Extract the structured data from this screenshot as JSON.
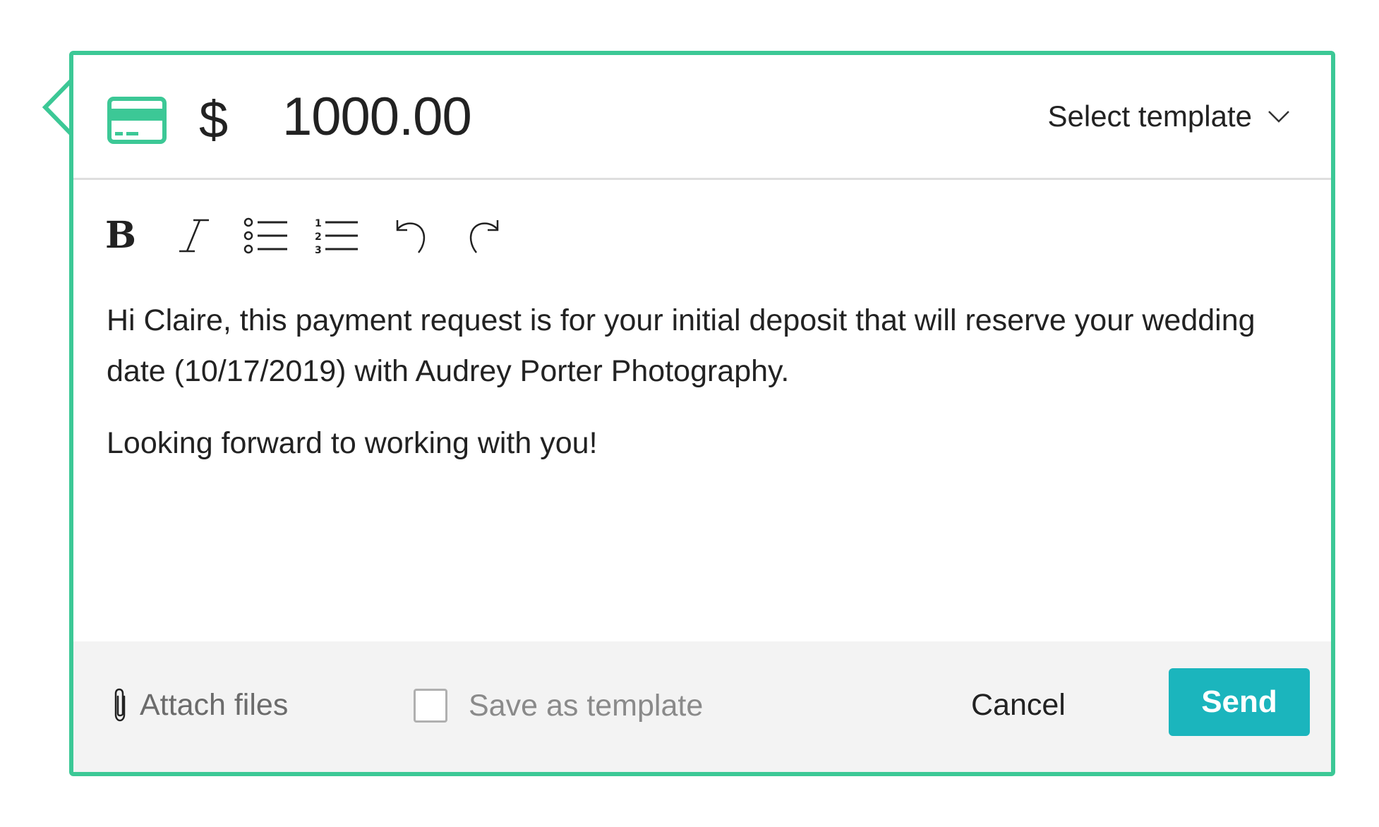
{
  "header": {
    "currency_symbol": "$",
    "amount": "1000.00",
    "template_select": {
      "label": "Select template",
      "icon": "chevron-down-icon"
    },
    "payment_icon": "credit-card-icon"
  },
  "toolbar": {
    "items": [
      {
        "name": "bold",
        "label": "B",
        "icon": "bold-icon"
      },
      {
        "name": "italic",
        "icon": "italic-icon"
      },
      {
        "name": "bulleted-list",
        "icon": "bulleted-list-icon"
      },
      {
        "name": "numbered-list",
        "icon": "numbered-list-icon"
      },
      {
        "name": "undo",
        "icon": "undo-icon"
      },
      {
        "name": "redo",
        "icon": "redo-icon"
      }
    ]
  },
  "message": {
    "paragraphs": [
      "Hi Claire, this payment request is for your initial deposit that will reserve your wedding date (10/17/2019) with Audrey Porter Photography.",
      "Looking forward to working with you!"
    ]
  },
  "footer": {
    "attach_label": "Attach files",
    "attach_icon": "paperclip-icon",
    "save_template_label": "Save as template",
    "save_template_checked": false,
    "cancel_label": "Cancel",
    "send_label": "Send"
  },
  "colors": {
    "accent_green": "#3cc896",
    "send_button": "#1bb5bd",
    "footer_bg": "#f3f3f3"
  }
}
